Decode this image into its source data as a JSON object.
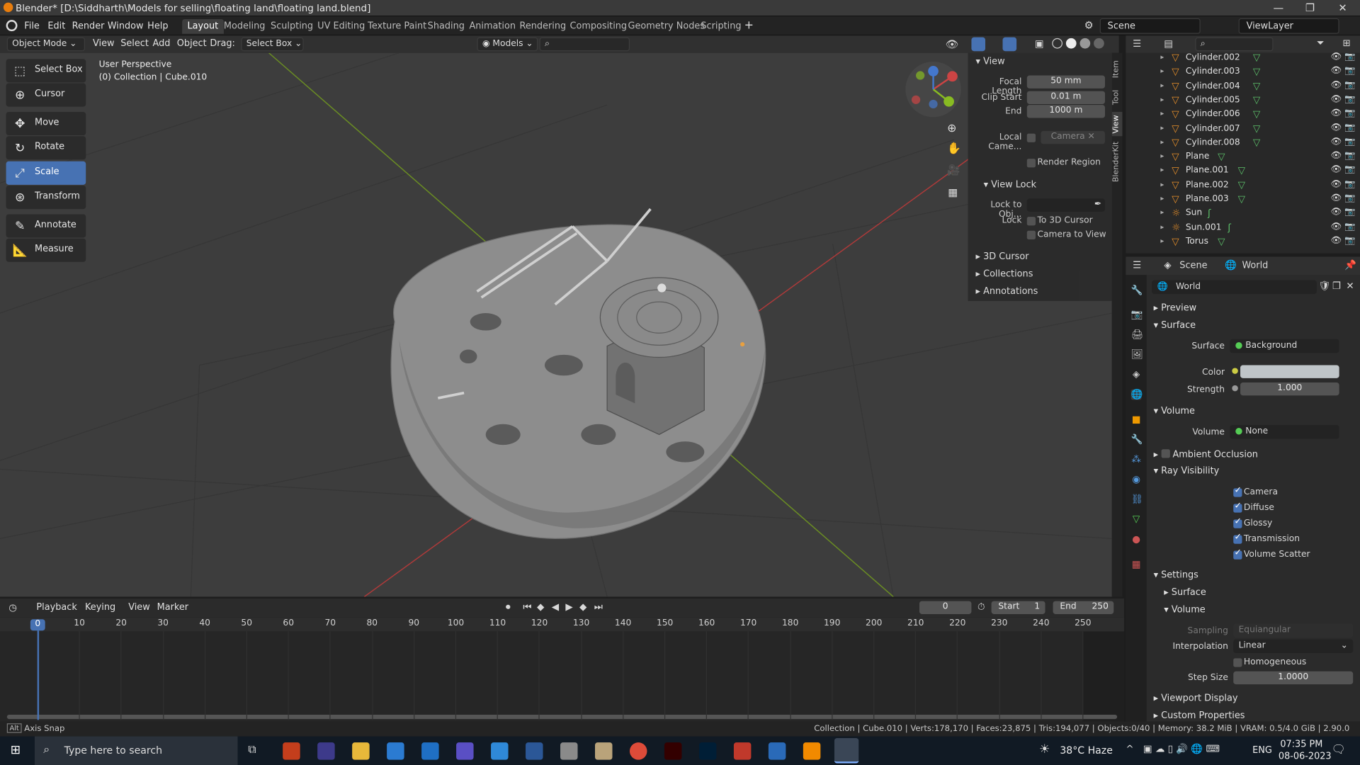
{
  "window": {
    "title": "Blender* [D:\\Siddharth\\Models for selling\\floating land\\floating land.blend]"
  },
  "menu": {
    "file": "File",
    "edit": "Edit",
    "render": "Render",
    "window": "Window",
    "help": "Help"
  },
  "workspaces": [
    "Layout",
    "Modeling",
    "Sculpting",
    "UV Editing",
    "Texture Paint",
    "Shading",
    "Animation",
    "Rendering",
    "Compositing",
    "Geometry Nodes",
    "Scripting"
  ],
  "scene": {
    "name": "Scene",
    "view_layer": "ViewLayer"
  },
  "viewport_header": {
    "mode": "Object Mode",
    "view": "View",
    "select": "Select",
    "add": "Add",
    "object": "Object",
    "drag_label": "Drag:",
    "drag_value": "Select Box",
    "collection": "Models"
  },
  "viewport": {
    "perspective": "User Perspective",
    "collection_info": "(0) Collection | Cube.010"
  },
  "tools": [
    "Select Box",
    "Cursor",
    "Move",
    "Rotate",
    "Scale",
    "Transform",
    "Annotate",
    "Measure"
  ],
  "n_panel": {
    "view_title": "View",
    "focal_length_label": "Focal Length",
    "focal_length": "50 mm",
    "clip_start_label": "Clip Start",
    "clip_start": "0.01 m",
    "end_label": "End",
    "end": "1000 m",
    "local_camera_label": "Local Came...",
    "local_camera": "Camera",
    "render_region": "Render Region",
    "view_lock_title": "View Lock",
    "lock_to_object_label": "Lock to Obj...",
    "lock_label": "Lock",
    "to_3d_cursor": "To 3D Cursor",
    "camera_to_view": "Camera to View",
    "sections": [
      "3D Cursor",
      "Collections",
      "Annotations"
    ],
    "tabs": [
      "Item",
      "Tool",
      "View",
      "BlenderKit"
    ]
  },
  "outliner": {
    "items": [
      {
        "name": "Cylinder.002",
        "type": "mesh"
      },
      {
        "name": "Cylinder.003",
        "type": "mesh"
      },
      {
        "name": "Cylinder.004",
        "type": "mesh"
      },
      {
        "name": "Cylinder.005",
        "type": "mesh"
      },
      {
        "name": "Cylinder.006",
        "type": "mesh"
      },
      {
        "name": "Cylinder.007",
        "type": "mesh"
      },
      {
        "name": "Cylinder.008",
        "type": "mesh"
      },
      {
        "name": "Plane",
        "type": "mesh"
      },
      {
        "name": "Plane.001",
        "type": "mesh"
      },
      {
        "name": "Plane.002",
        "type": "mesh"
      },
      {
        "name": "Plane.003",
        "type": "mesh"
      },
      {
        "name": "Sun",
        "type": "light"
      },
      {
        "name": "Sun.001",
        "type": "light"
      },
      {
        "name": "Torus",
        "type": "mesh"
      }
    ]
  },
  "properties": {
    "breadcrumb_scene": "Scene",
    "breadcrumb_world": "World",
    "world_name": "World",
    "preview": "Preview",
    "surface_header": "Surface",
    "surface_label": "Surface",
    "surface_value": "Background",
    "color_label": "Color",
    "strength_label": "Strength",
    "strength_value": "1.000",
    "volume_header": "Volume",
    "volume_label": "Volume",
    "volume_value": "None",
    "ambient_occlusion": "Ambient Occlusion",
    "ray_visibility": "Ray Visibility",
    "ray_items": [
      "Camera",
      "Diffuse",
      "Glossy",
      "Transmission",
      "Volume Scatter"
    ],
    "settings": "Settings",
    "settings_surface": "Surface",
    "settings_volume": "Volume",
    "sampling_label": "Sampling",
    "sampling_value": "Equiangular",
    "interpolation_label": "Interpolation",
    "interpolation_value": "Linear",
    "homogeneous": "Homogeneous",
    "step_size_label": "Step Size",
    "step_size_value": "1.0000",
    "viewport_display": "Viewport Display",
    "custom_properties": "Custom Properties",
    "world_color": "#bfc5c8"
  },
  "timeline": {
    "playback": "Playback",
    "keying": "Keying",
    "view": "View",
    "marker": "Marker",
    "current_frame": "0",
    "start_label": "Start",
    "start": "1",
    "end_label": "End",
    "end": "250",
    "ticks": [
      "0",
      "10",
      "20",
      "30",
      "40",
      "50",
      "60",
      "70",
      "80",
      "90",
      "100",
      "110",
      "120",
      "130",
      "140",
      "150",
      "160",
      "170",
      "180",
      "190",
      "200",
      "210",
      "220",
      "230",
      "240",
      "250"
    ]
  },
  "status_bar": {
    "left": "Axis Snap",
    "right": "Collection | Cube.010 | Verts:178,170 | Faces:23,875 | Tris:194,077 | Objects:0/40 | Memory: 38.2 MiB | VRAM: 0.5/4.0 GiB | 2.90.0"
  },
  "taskbar": {
    "search_placeholder": "Type here to search",
    "weather": "38°C  Haze",
    "lang": "ENG",
    "time": "07:35 PM",
    "date": "08-06-2023"
  }
}
